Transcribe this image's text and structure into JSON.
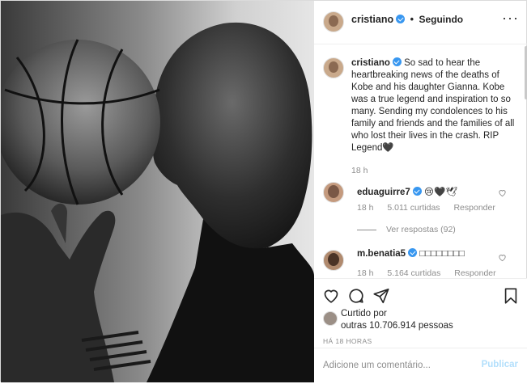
{
  "post": {
    "author": "cristiano",
    "follow_status": "Seguindo",
    "separator": "•",
    "more_icon": "more-horizontal-icon"
  },
  "caption": {
    "author": "cristiano",
    "text": "So sad to hear the heartbreaking news of the deaths of Kobe and his daughter Gianna. Kobe was a true legend and inspiration to so many. Sending my condolences to his family and friends and the families of all who lost their lives in the crash. RIP Legend🖤",
    "time": "18 h"
  },
  "comments": [
    {
      "author": "eduaguirre7",
      "text": "😢🖤🕊",
      "time": "18 h",
      "likes": "5.011 curtidas",
      "reply": "Responder",
      "view_replies": "Ver respostas (92)"
    },
    {
      "author": "m.benatia5",
      "text": "□□□□□□□□",
      "time": "18 h",
      "likes": "5.164 curtidas",
      "reply": "Responder"
    }
  ],
  "actions": {
    "like_icon": "heart-outline-icon",
    "comment_icon": "comment-icon",
    "share_icon": "paper-plane-icon",
    "save_icon": "bookmark-icon"
  },
  "likes": {
    "label": "Curtido por",
    "others": "outras 10.706.914 pessoas"
  },
  "posted_ago": "HÁ 18 HORAS",
  "add_comment": {
    "placeholder": "Adicione um comentário...",
    "publish_label": "Publicar"
  },
  "colors": {
    "accent_blue": "#3897f0",
    "publish_disabled": "#b2dffc",
    "muted_text": "#8e8e8e",
    "text": "#262626"
  }
}
